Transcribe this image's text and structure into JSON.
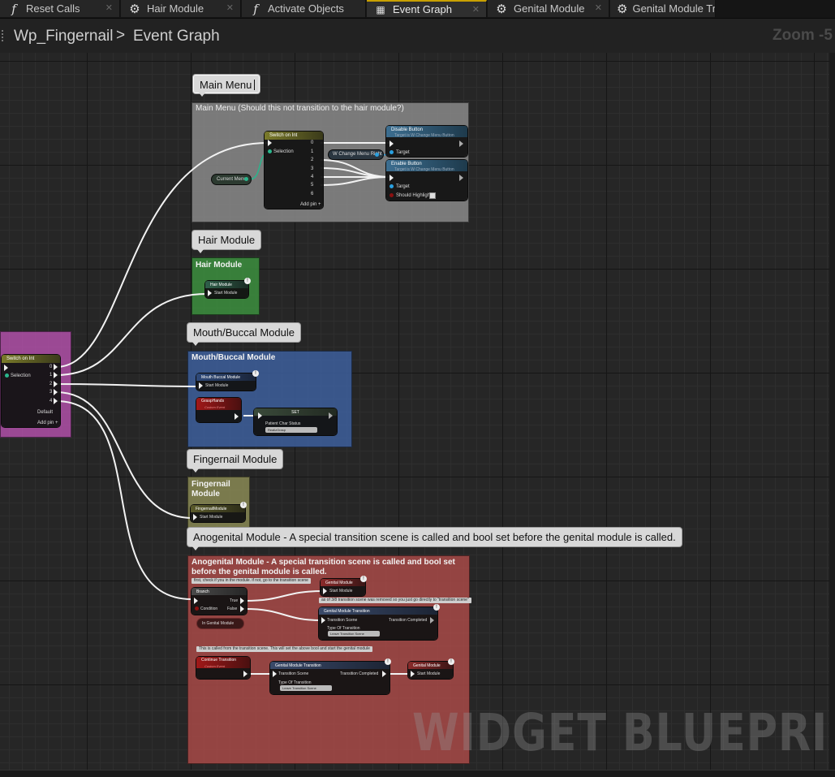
{
  "tabs": [
    {
      "label": "Reset Calls",
      "icon": "function-icon"
    },
    {
      "label": "Hair Module",
      "icon": "gear-icon"
    },
    {
      "label": "Activate Objects",
      "icon": "function-icon"
    },
    {
      "label": "Event Graph",
      "icon": "event-graph-icon"
    },
    {
      "label": "Genital Module",
      "icon": "gear-icon"
    },
    {
      "label": "Genital Module Tra",
      "icon": "gear-icon"
    }
  ],
  "breadcrumb": {
    "widget": "Wp_Fingernail",
    "separator": ">",
    "graph": "Event Graph"
  },
  "zoom": "Zoom -5",
  "watermark": "WIDGET BLUEPRINT",
  "comments": {
    "main_menu_bubble": "Main Menu",
    "main_menu_box": "Main Menu (Should this not transition to the hair module?)",
    "hair_bubble": "Hair Module",
    "hair_box": "Hair Module",
    "mouth_bubble": "Mouth/Buccal Module",
    "mouth_box": "Mouth/Buccal Module",
    "finger_bubble": "Fingernail Module",
    "finger_box": "Fingernail Module",
    "anogenital_bubble": "Anogenital Module - A special transition scene is called and bool set before the genital module is called.",
    "anogenital_box": "Anogenital Module - A special transition scene is called and bool set before the genital module is called."
  },
  "nodes": {
    "switch_left": {
      "title": "Switch on Int",
      "selection": "Selection",
      "outs": [
        "0",
        "1",
        "2",
        "3",
        "4"
      ],
      "default": "Default",
      "add_pin": "Add pin +"
    },
    "switch_menu": {
      "title": "Switch on Int",
      "selection": "Selection",
      "outs": [
        "0",
        "1",
        "2",
        "3",
        "4",
        "5",
        "6"
      ],
      "add_pin": "Add pin +"
    },
    "current_menu": "Current Menu",
    "change_menu_right": "W Change Menu Right",
    "disable_button": {
      "title": "Disable Button",
      "subtitle": "Target is W Change Menu Button",
      "target": "Target"
    },
    "enable_button": {
      "title": "Enable Button",
      "subtitle": "Target is W Change Menu Button",
      "target": "Target",
      "should_highlight": "Should Highlight"
    },
    "hair_module_node": {
      "title": "Hair Module",
      "pin": "Start Module"
    },
    "mouth_module_node": {
      "title": "Mouth Buccal Module",
      "pin": "Start Module"
    },
    "grasp_hands": {
      "title": "GraspHands",
      "subtitle": "Custom Event"
    },
    "set_node": {
      "title": "SET",
      "label": "Patient Char Status",
      "value": "RealizGrasp"
    },
    "fingernail_module_node": {
      "title": "FingernailModule",
      "pin": "Start Module"
    },
    "note_first_check": "first, check if you in the module. if not, go to the transition scene",
    "genital_module_1": {
      "title": "Genital Module",
      "pin": "Start Module"
    },
    "note_removed": "as of 3/8 transition scene was removed so you just go directly to \"transition scene\"",
    "branch": {
      "title": "Branch",
      "condition": "Condition",
      "true": "True",
      "false": "False"
    },
    "in_genital_module": "In Genital Module",
    "genital_module_transition_1": {
      "title": "Genital Module Transition",
      "transition_scene": "Transition Scene",
      "transition_completed": "Transition Completed",
      "type_label": "Type Of Transition",
      "type_value": "Leave Transition Scene"
    },
    "note_called_from": "This is called from the transition scene. This will set the above bool and start the genital module",
    "continue_transition": {
      "title": "Continue Transition",
      "subtitle": "Custom Event"
    },
    "genital_module_transition_2": {
      "title": "Genital Module Transition",
      "transition_scene": "Transition Scene",
      "transition_completed": "Transition Completed",
      "type_label": "Type Of Transition",
      "type_value": "Leave Transition Scene"
    },
    "genital_module_2": {
      "title": "Genital Module",
      "pin": "Start Module"
    }
  },
  "colors": {
    "main_menu_box": "#8a8a8a",
    "hair_box": "#3c8f3e",
    "mouth_box": "#3d5f9c",
    "finger_box": "#8a8a55",
    "anogenital_box": "#a84a48",
    "pink_box": "#b050a8"
  }
}
